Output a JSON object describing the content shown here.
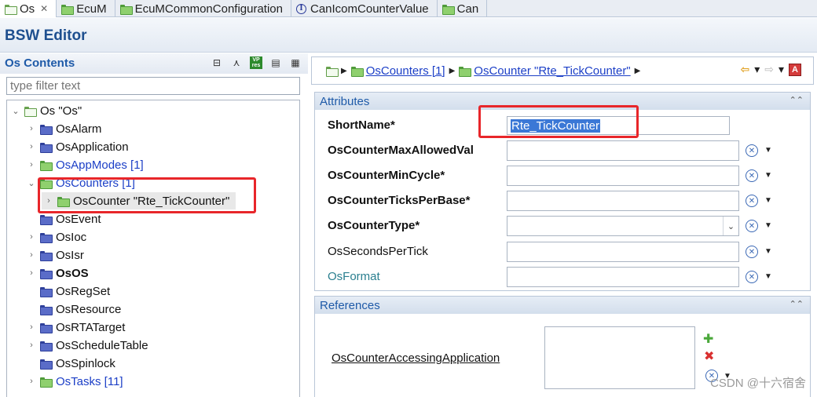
{
  "tabs": [
    {
      "label": "Os",
      "icon": "os-icon",
      "active": true,
      "closable": true
    },
    {
      "label": "EcuM",
      "icon": "folder-icon"
    },
    {
      "label": "EcuMCommonConfiguration",
      "icon": "folder-icon"
    },
    {
      "label": "CanIcomCounterValue",
      "icon": "info-icon"
    },
    {
      "label": "Can",
      "icon": "folder-icon"
    }
  ],
  "editor": {
    "title": "BSW Editor"
  },
  "left_panel": {
    "title": "Os Contents",
    "filter_placeholder": "type filter text",
    "tree": [
      {
        "label": "Os \"Os\"",
        "icon": "outline-folder"
      },
      {
        "label": "OsAlarm",
        "icon": "blue-folder"
      },
      {
        "label": "OsApplication",
        "icon": "blue-folder"
      },
      {
        "label": "OsAppModes [1]",
        "icon": "green-folder"
      },
      {
        "label": "OsCounters [1]",
        "icon": "green-folder"
      },
      {
        "label": "OsCounter \"Rte_TickCounter\"",
        "icon": "green-folder"
      },
      {
        "label": "OsEvent",
        "icon": "blue-folder"
      },
      {
        "label": "OsIoc",
        "icon": "blue-folder"
      },
      {
        "label": "OsIsr",
        "icon": "blue-folder"
      },
      {
        "label": "OsOS",
        "icon": "blue-folder"
      },
      {
        "label": "OsRegSet",
        "icon": "blue-folder"
      },
      {
        "label": "OsResource",
        "icon": "blue-folder"
      },
      {
        "label": "OsRTATarget",
        "icon": "blue-folder"
      },
      {
        "label": "OsScheduleTable",
        "icon": "blue-folder"
      },
      {
        "label": "OsSpinlock",
        "icon": "blue-folder"
      },
      {
        "label": "OsTasks [11]",
        "icon": "green-folder"
      }
    ]
  },
  "breadcrumb": {
    "items": [
      "OsCounters [1]",
      "OsCounter \"Rte_TickCounter\""
    ]
  },
  "attributes": {
    "title": "Attributes",
    "fields": [
      {
        "label": "ShortName*",
        "value": "Rte_TickCounter"
      },
      {
        "label": "OsCounterMaxAllowedVal",
        "value": ""
      },
      {
        "label": "OsCounterMinCycle*",
        "value": ""
      },
      {
        "label": "OsCounterTicksPerBase*",
        "value": ""
      },
      {
        "label": "OsCounterType*",
        "value": ""
      },
      {
        "label": "OsSecondsPerTick",
        "value": ""
      },
      {
        "label": "OsFormat",
        "value": ""
      }
    ]
  },
  "references": {
    "title": "References",
    "label": "OsCounterAccessingApplication"
  },
  "watermark": "CSDN @十六宿舍",
  "colors": {
    "highlight": "#e8262a",
    "link": "#1c3fc7",
    "title": "#1e4f8f"
  }
}
